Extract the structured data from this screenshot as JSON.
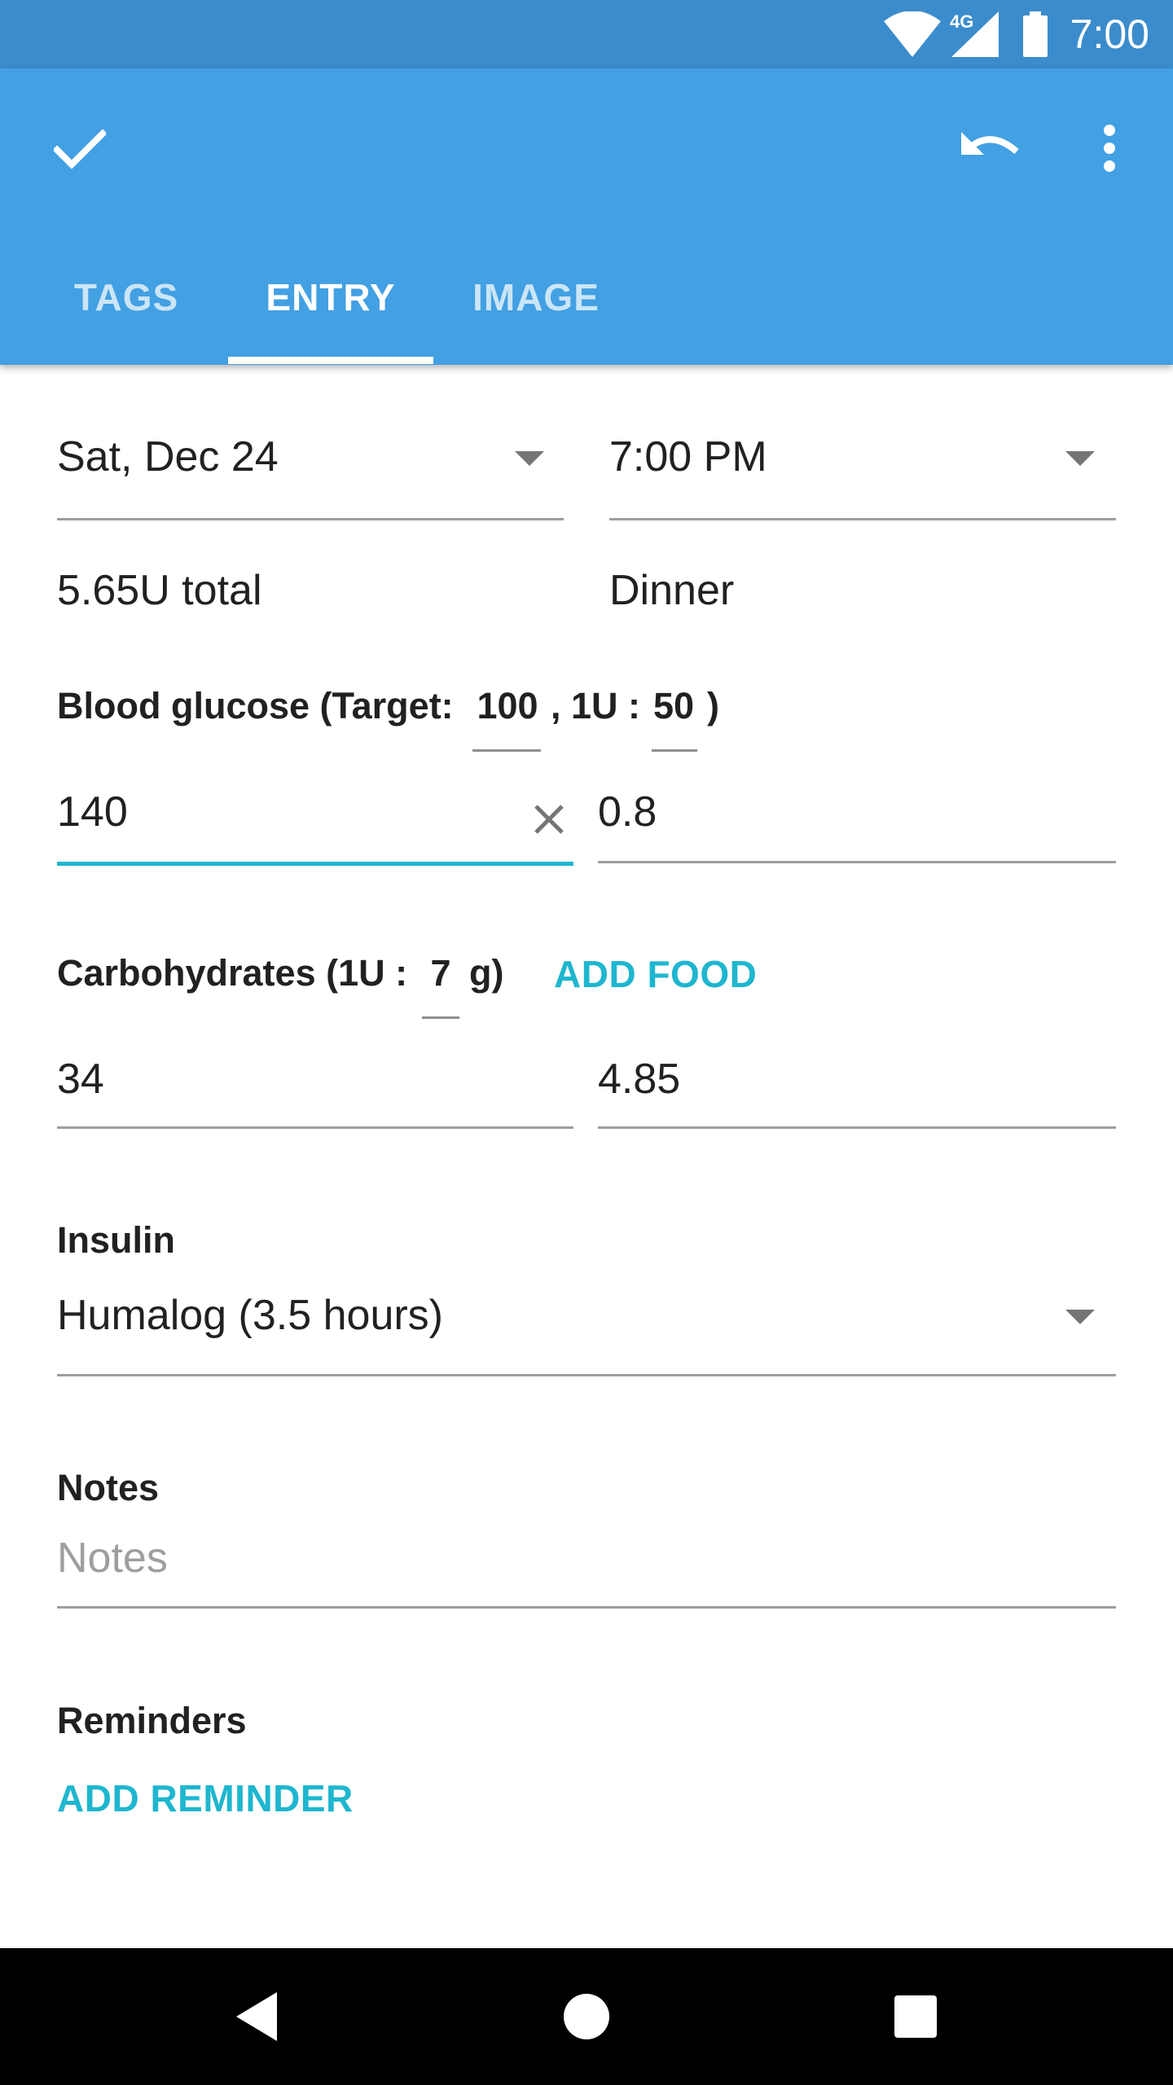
{
  "status_bar": {
    "time": "7:00",
    "network": "4G",
    "icons": [
      "wifi-icon",
      "cell-signal-icon",
      "battery-icon"
    ]
  },
  "toolbar": {
    "icons": [
      "check-icon",
      "undo-icon",
      "more-vert-icon"
    ]
  },
  "tabs": [
    {
      "label": "TAGS",
      "active": false
    },
    {
      "label": "ENTRY",
      "active": true
    },
    {
      "label": "IMAGE",
      "active": false
    }
  ],
  "entry": {
    "date": "Sat, Dec 24",
    "time": "7:00 PM",
    "total": "5.65U total",
    "meal": "Dinner",
    "blood_glucose": {
      "label_prefix": "Blood glucose (Target:",
      "target": "100",
      "label_middle": ", 1U :",
      "factor": "50",
      "label_suffix": ")",
      "value": "140",
      "units": "0.8"
    },
    "carbohydrates": {
      "label_prefix": "Carbohydrates (1U :",
      "factor": "7",
      "label_suffix": "g)",
      "add_food": "ADD FOOD",
      "value": "34",
      "units": "4.85"
    },
    "insulin": {
      "label": "Insulin",
      "value": "Humalog (3.5 hours)"
    },
    "notes": {
      "label": "Notes",
      "placeholder": "Notes"
    },
    "reminders": {
      "label": "Reminders",
      "add_reminder": "ADD REMINDER"
    }
  },
  "colors": {
    "status_bar": "#3b8ccc",
    "app_bar": "#42a0e3",
    "accent": "#1eb6cf",
    "nav_bar": "#000000"
  }
}
